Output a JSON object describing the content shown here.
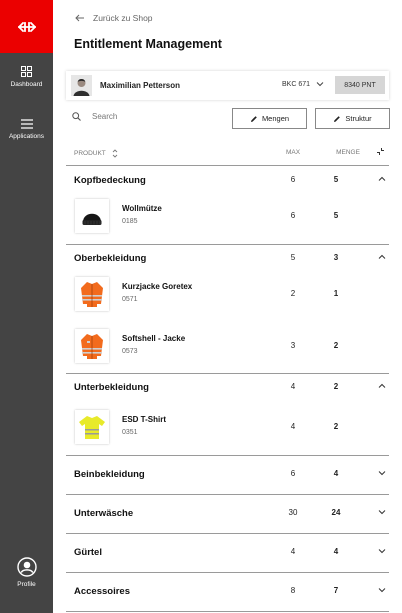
{
  "sidebar": {
    "nav": [
      {
        "label": "Dashboard",
        "icon": "dashboard-icon"
      },
      {
        "label": "Applications",
        "icon": "menu-icon"
      }
    ],
    "profile": {
      "label": "Profile",
      "icon": "profile-icon"
    }
  },
  "header": {
    "back_label": "Zurück zu Shop",
    "title": "Entitlement Management"
  },
  "user_bar": {
    "name": "Maximilian Petterson",
    "cost_center": "BKC 671",
    "points": "8340 PNT"
  },
  "toolbar": {
    "search_placeholder": "Search",
    "mengen_label": "Mengen",
    "struktur_label": "Struktur"
  },
  "table": {
    "col_product": "PRODUKT",
    "col_max": "MAX",
    "col_menge": "MENGE"
  },
  "categories": [
    {
      "name": "Kopfbedeckung",
      "max": "6",
      "menge": "5",
      "expanded": true,
      "items": [
        {
          "name": "Wollmütze",
          "code": "0185",
          "max": "6",
          "menge": "5",
          "icon": "beanie-icon"
        }
      ]
    },
    {
      "name": "Oberbekleidung",
      "max": "5",
      "menge": "3",
      "expanded": true,
      "items": [
        {
          "name": "Kurzjacke Goretex",
          "code": "0571",
          "max": "2",
          "menge": "1",
          "icon": "orange-jacket-icon"
        },
        {
          "name": "Softshell - Jacke",
          "code": "0573",
          "max": "3",
          "menge": "2",
          "icon": "orange-softshell-icon"
        }
      ]
    },
    {
      "name": "Unterbekleidung",
      "max": "4",
      "menge": "2",
      "expanded": true,
      "items": [
        {
          "name": "ESD T-Shirt",
          "code": "0351",
          "max": "4",
          "menge": "2",
          "icon": "yellow-tshirt-icon"
        }
      ]
    },
    {
      "name": "Beinbekleidung",
      "max": "6",
      "menge": "4",
      "expanded": false,
      "items": []
    },
    {
      "name": "Unterwäsche",
      "max": "30",
      "menge": "24",
      "expanded": false,
      "items": []
    },
    {
      "name": "Gürtel",
      "max": "4",
      "menge": "4",
      "expanded": false,
      "items": []
    },
    {
      "name": "Accessoires",
      "max": "8",
      "menge": "7",
      "expanded": false,
      "items": []
    }
  ],
  "colors": {
    "brand_red": "#eb0000",
    "sidebar_bg": "#444444",
    "safety_orange": "#f26b1d",
    "safety_yellow": "#e8ea2a"
  }
}
